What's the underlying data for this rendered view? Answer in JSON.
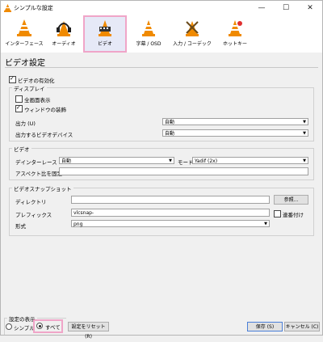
{
  "window": {
    "title": "シンプルな設定",
    "minimize": "—",
    "maximize": "☐",
    "close": "✕"
  },
  "toolbar": {
    "tabs": [
      {
        "label": "インターフェース",
        "icon": "interface-cone-icon"
      },
      {
        "label": "オーディオ",
        "icon": "audio-headphones-icon"
      },
      {
        "label": "ビデオ",
        "icon": "video-cone-icon",
        "selected": true
      },
      {
        "label": "字幕 / OSD",
        "icon": "subtitles-cone-icon"
      },
      {
        "label": "入力 / コーデック",
        "icon": "codec-cone-icon"
      },
      {
        "label": "ホットキー",
        "icon": "hotkeys-cone-icon"
      }
    ]
  },
  "page": {
    "title": "ビデオ設定",
    "enable_video": "ビデオの有効化"
  },
  "display": {
    "group_title": "ディスプレイ",
    "fullscreen": "全画面表示",
    "window_decoration": "ウィンドウの装飾",
    "output_label": "出力 (U)",
    "output_value": "自動",
    "output_device_label": "出力するビデオデバイス",
    "output_device_value": "自動"
  },
  "video": {
    "group_title": "ビデオ",
    "deinterlace_label": "デインターレース",
    "deinterlace_value": "自動",
    "mode_label": "モード",
    "mode_value": "Yadif (2x)",
    "aspect_label": "アスペクト比を固定",
    "aspect_value": ""
  },
  "snapshot": {
    "group_title": "ビデオスナップショット",
    "directory_label": "ディレクトリ",
    "directory_value": "",
    "browse_button": "参照...",
    "prefix_label": "プレフィックス",
    "prefix_value": "vlcsnap-",
    "sequential_label": "連番付け",
    "format_label": "形式",
    "format_value": "png"
  },
  "footer": {
    "show_settings": "設定の表示",
    "simple": "シンプル",
    "all": "すべて",
    "reset": "設定をリセット (R)",
    "save": "保存 (S)",
    "cancel": "キャンセル (C)"
  }
}
